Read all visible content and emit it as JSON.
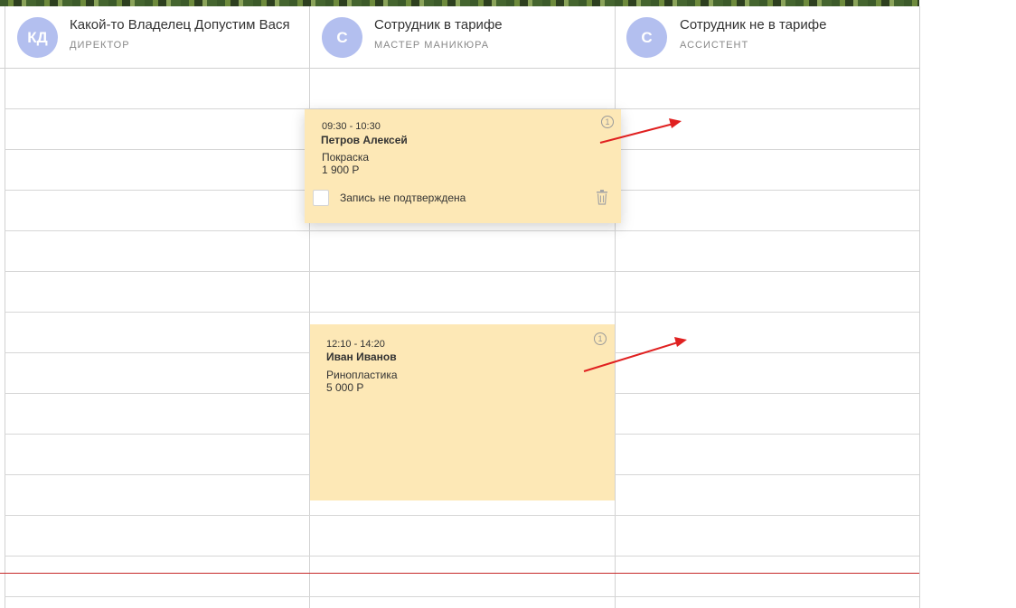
{
  "employees": [
    {
      "initials": "КД",
      "name": "Какой-то Владелец Допустим Вася",
      "role": "ДИРЕКТОР"
    },
    {
      "initials": "С",
      "name": "Сотрудник в тарифе",
      "role": "МАСТЕР МАНИКЮРА"
    },
    {
      "initials": "С",
      "name": "Сотрудник не в тарифе",
      "role": "АССИСТЕНТ"
    }
  ],
  "appointments": [
    {
      "time": "09:30 - 10:30",
      "client": "Петров Алексей",
      "service": "Покраска",
      "price": "1 900 Р",
      "confirm_label": "Запись не подтверждена",
      "info": "1"
    },
    {
      "time": "12:10 - 14:20",
      "client": "Иван Иванов",
      "service": "Ринопластика",
      "price": "5 000 Р",
      "info": "1"
    }
  ],
  "colors": {
    "avatar": "#b3bfef",
    "appointment": "#fde8b6",
    "now_line": "#c62a2a",
    "arrow": "#e02020"
  },
  "icons": [
    "info-icon",
    "trash-icon",
    "checkbox"
  ]
}
